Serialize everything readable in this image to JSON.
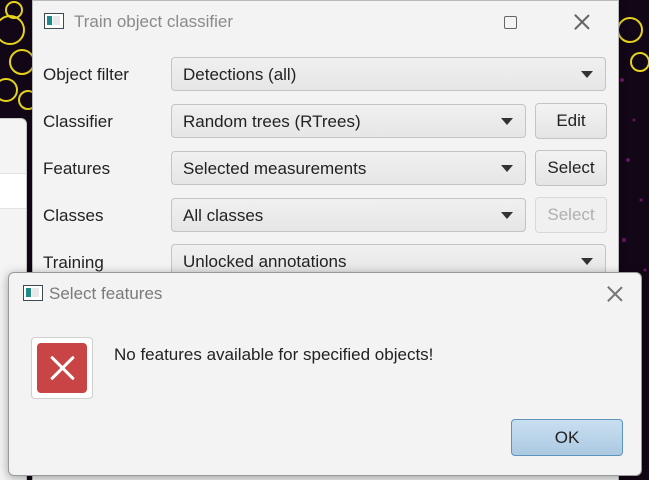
{
  "main_window": {
    "title": "Train object classifier",
    "icon": "app-window-icon"
  },
  "form": {
    "object_filter": {
      "label": "Object filter",
      "value": "Detections (all)"
    },
    "classifier": {
      "label": "Classifier",
      "value": "Random trees (RTrees)",
      "button": "Edit"
    },
    "features": {
      "label": "Features",
      "value": "Selected measurements",
      "button": "Select"
    },
    "classes": {
      "label": "Classes",
      "value": "All classes",
      "button": "Select"
    },
    "training": {
      "label": "Training",
      "value": "Unlocked annotations"
    }
  },
  "dialog": {
    "title": "Select features",
    "message": "No features available for specified objects!",
    "ok_label": "OK",
    "icon": "error-icon"
  },
  "colors": {
    "error_red": "#c94444",
    "ok_blue": "#acc9e2",
    "overlay_yellow": "#e6d21a"
  }
}
